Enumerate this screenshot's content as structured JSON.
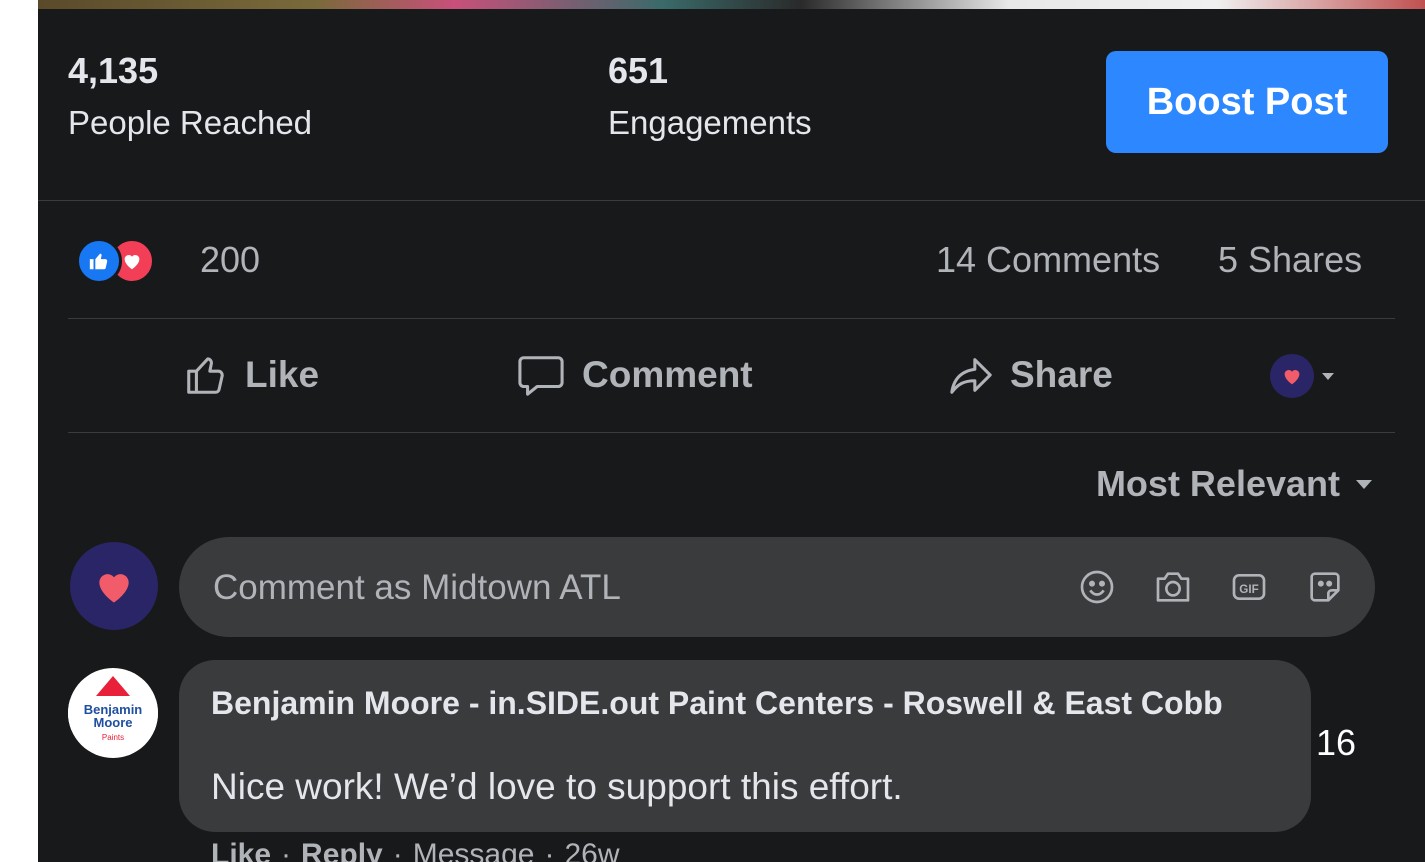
{
  "stats": {
    "reach_value": "4,135",
    "reach_label": "People Reached",
    "engagements_value": "651",
    "engagements_label": "Engagements",
    "boost_label": "Boost Post"
  },
  "reactions": {
    "count": "200",
    "comments": "14 Comments",
    "shares": "5 Shares"
  },
  "actions": {
    "like": "Like",
    "comment": "Comment",
    "share": "Share"
  },
  "sort": {
    "label": "Most Relevant"
  },
  "composer": {
    "placeholder": "Comment as Midtown ATL"
  },
  "comment": {
    "avatar_text": "Benjamin Moore",
    "author": "Benjamin Moore - in.SIDE.out Paint Centers - Roswell & East Cobb",
    "text": "Nice work! We’d love to support this effort.",
    "like": "Like",
    "reply": "Reply",
    "message": "Message",
    "age": "26w",
    "sep": "·"
  },
  "page_number": "16",
  "colors": {
    "background": "#18191a",
    "accent": "#2d88ff",
    "like_blue": "#1877f2",
    "love_red": "#f33e58",
    "text_primary": "#e4e6eb",
    "text_secondary": "#b0b3b8",
    "bubble": "#3a3b3c"
  },
  "icons": [
    "like-reaction-icon",
    "love-reaction-icon",
    "thumbs-up-icon",
    "comment-icon",
    "share-arrow-icon",
    "page-avatar-heart-icon",
    "chevron-down-icon",
    "emoji-icon",
    "camera-icon",
    "gif-icon",
    "sticker-icon"
  ]
}
